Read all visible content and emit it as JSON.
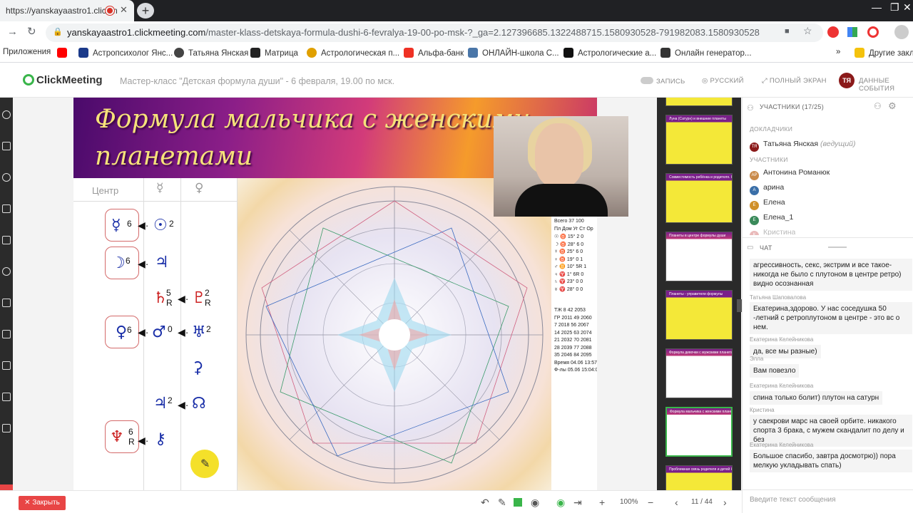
{
  "browser": {
    "tab_title": "https://yanskayaastro1.clickm",
    "url_host": "yanskayaastro1.clickmeeting.com",
    "url_path": "/master-klass-detskaya-formula-dushi-6-fevralya-19-00-po-msk-?_ga=2.127396685.1322488715.1580930528-791982083.1580930528",
    "bookmarks": [
      {
        "label": "Приложения",
        "color": "#4285f4"
      },
      {
        "label": "",
        "color": "#ff0000"
      },
      {
        "label": "Астропсихолог Янс...",
        "color": "#1b3a8a"
      },
      {
        "label": "Татьяна Янская",
        "color": "#444"
      },
      {
        "label": "Матрица",
        "color": "#222"
      },
      {
        "label": "Астрологическая п...",
        "color": "#e0a000"
      },
      {
        "label": "Альфа-банк",
        "color": "#ef3124"
      },
      {
        "label": "ОНЛАЙН-школа С...",
        "color": "#4a76a8"
      },
      {
        "label": "Астрологические а...",
        "color": "#111"
      },
      {
        "label": "Онлайн генератор...",
        "color": "#333"
      },
      {
        "label": "Другие закладки",
        "color": "#f4c20d"
      }
    ],
    "bookmarks_overflow": "»"
  },
  "header": {
    "logo": "ClickMeeting",
    "event_title": "Мастер-класс \"Детская формула души\" - 6 февраля, 19.00 по мск.",
    "record_label": "ЗАПИСЬ",
    "language_label": "РУССКИЙ",
    "fullscreen_label": "ПОЛНЫЙ ЭКРАН",
    "event_data_label": "ДАННЫЕ СОБЫТИЯ",
    "avatar_initials": "ТЯ"
  },
  "slide": {
    "title_line1": "Формула мальчика с женскими",
    "title_line2": "планетами",
    "col_center": "Центр",
    "col_mercury": "☿",
    "col_venus": "♀",
    "stats_header": [
      "Всего",
      "37",
      "100"
    ],
    "stats_cols": [
      "Пл",
      "Дом",
      "Уг",
      "Ст",
      "Ор"
    ],
    "stats_rows": [
      [
        "☉",
        "♉",
        "15°",
        "2",
        "0"
      ],
      [
        "☽",
        "♉",
        "28°",
        "6",
        "0"
      ],
      [
        "☿",
        "♉",
        "25°",
        "6",
        "0"
      ],
      [
        "♀",
        "♉",
        "19°",
        "0",
        "1"
      ],
      [
        "♂",
        "♊",
        "10°",
        "5R",
        "1"
      ],
      [
        "♃",
        "♈",
        "1°",
        "6R",
        "0"
      ],
      [
        "♄",
        "♈",
        "23°",
        "0",
        "0"
      ],
      [
        "♅",
        "♈",
        "28°",
        "0",
        "0"
      ]
    ],
    "stats_summary": [
      [
        "ТЖ",
        "8",
        "42",
        "2053"
      ],
      [
        "ГР",
        "2011",
        "49",
        "2060"
      ],
      [
        "7",
        "2018",
        "56",
        "2067"
      ],
      [
        "14",
        "2025",
        "63",
        "2074"
      ],
      [
        "21",
        "2032",
        "70",
        "2081"
      ],
      [
        "28",
        "2039",
        "77",
        "2088"
      ],
      [
        "35",
        "2046",
        "84",
        "2095"
      ]
    ],
    "stats_time": "Время 04.06 13:57:00",
    "stats_date": "Ф-лы 05.06 15:04:00"
  },
  "bottom_bar": {
    "close_label": "Закрыть",
    "zoom": "100%",
    "page_indicator": "11 / 44"
  },
  "thumbnails": [
    {
      "caption": "",
      "kind": "yellow"
    },
    {
      "caption": "Луна (Сатурн) и внешние планеты",
      "kind": "yellow"
    },
    {
      "caption": "Совместимость ребёнка и родителя. Карта ребёнка",
      "kind": "yellow"
    },
    {
      "caption": "Планеты в центре формулы души",
      "kind": "chart"
    },
    {
      "caption": "Планеты - управители формулы",
      "kind": "yellow"
    },
    {
      "caption": "Формула девочки с мужскими планетами",
      "kind": "chart"
    },
    {
      "caption": "Формула мальчика с женскими планетами",
      "kind": "chart",
      "active": true
    },
    {
      "caption": "Проблемная связь родителя и детей Кто ...",
      "kind": "yellow"
    }
  ],
  "participants": {
    "header": "УЧАСТНИКИ (17/25)",
    "presenters_label": "ДОКЛАДЧИКИ",
    "presenter": {
      "name": "Татьяна Янская",
      "role": "(ведущий)",
      "initials": "ТЯ",
      "color": "#8b1a1a"
    },
    "attendees_label": "УЧАСТНИКИ",
    "attendees": [
      {
        "name": "Антонина Романюк",
        "initials": "АР",
        "color": "#c98a4a"
      },
      {
        "name": "арина",
        "initials": "А",
        "color": "#3a6fa8"
      },
      {
        "name": "Елена",
        "initials": "Е",
        "color": "#d0902a"
      },
      {
        "name": "Елена_1",
        "initials": "Е",
        "color": "#3a8a5a"
      },
      {
        "name": "Кристина",
        "initials": "К",
        "color": "#c23a3a"
      }
    ]
  },
  "chat": {
    "header": "ЧАТ",
    "messages": [
      {
        "author": "",
        "text": "агрессивность, секс, экстрим и все такое-никогда не было с плутоном в центре ретро) видно осознанная"
      },
      {
        "author": "Татьяна Шаповалова",
        "text": "Екатерина,здорово. У нас соседушка 50 -летний с ретроплутоном в центре - это вс о нем."
      },
      {
        "author": "Екатерина Келейникова",
        "text": "да, все мы разные)"
      },
      {
        "author": "Элла",
        "text": "Вам повезло"
      },
      {
        "author": "Екатерина Келейникова",
        "text": "спина только болит) плутон на сатурн"
      },
      {
        "author": "Кристина",
        "text": "у саекрови марс на своей орбите. никакого спорта 3 брака, с мужем скандалит по делу и без"
      },
      {
        "author": "Екатерина Келейникова",
        "text": "Большое спасибо, завтра досмотрю)) пора мелкую укладывать спать)"
      }
    ],
    "input_placeholder": "Введите текст сообщения"
  }
}
